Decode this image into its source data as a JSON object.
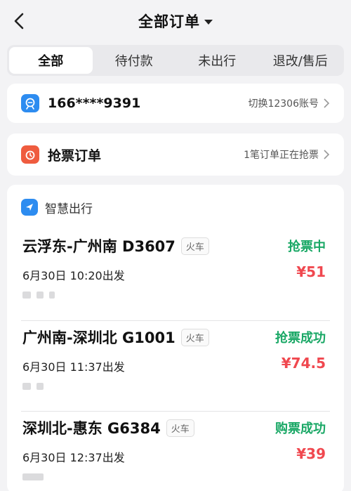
{
  "header": {
    "title": "全部订单"
  },
  "tabs": [
    "全部",
    "待付款",
    "未出行",
    "退改/售后"
  ],
  "account": {
    "phone": "166****9391",
    "action": "切换12306账号"
  },
  "grab": {
    "title": "抢票订单",
    "status": "1笔订单正在抢票"
  },
  "orders_section": {
    "label": "智慧出行",
    "items": [
      {
        "route": "云浮东-广州南 D3607",
        "type": "火车",
        "status": "抢票中",
        "time": "6月30日 10:20出发",
        "price": "¥51"
      },
      {
        "route": "广州南-深圳北 G1001",
        "type": "火车",
        "status": "抢票成功",
        "time": "6月30日 11:37出发",
        "price": "¥74.5"
      },
      {
        "route": "深圳北-惠东 G6384",
        "type": "火车",
        "status": "购票成功",
        "time": "6月30日 12:37出发",
        "price": "¥39"
      }
    ]
  },
  "colors": {
    "green": "#1aa866",
    "red": "#f0484f",
    "blue": "#2d8cf0",
    "orange": "#ef5c3f"
  }
}
